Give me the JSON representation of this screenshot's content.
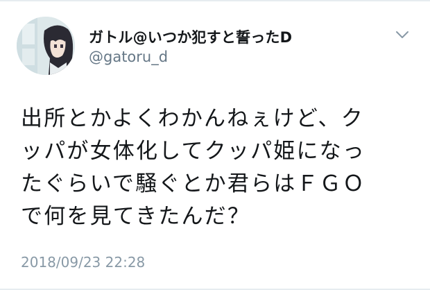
{
  "user": {
    "display_name": "ガトル@いつか犯すと誓ったD",
    "handle": "@gatoru_d",
    "avatar_icon": "anime-character-avatar-icon"
  },
  "tweet": {
    "lines": [
      "出所とかよくわかんねぇけど、ク",
      "ッパが女体化してクッパ姫になっ",
      "たぐらいで騒ぐとか君らはＦＧＯ",
      "で何を見てきたんだ？"
    ],
    "timestamp": "2018/09/23 22:28"
  },
  "menu": {
    "icon": "chevron-down-icon"
  },
  "colors": {
    "name": "#14171a",
    "handle": "#657786",
    "timestamp": "#8899a6",
    "divider": "#e6ecf0"
  }
}
